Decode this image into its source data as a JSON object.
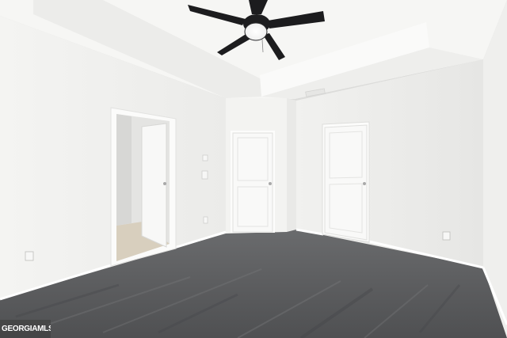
{
  "watermark": {
    "text": "GEORGIAMLS"
  },
  "colors": {
    "wall": "#f2f2f0",
    "ceiling": "#f7f7f5",
    "carpet": "#5e5f61",
    "door": "#f9f9f8",
    "fan_blade": "#1c1c1e",
    "fan_light": "#ffffff"
  }
}
